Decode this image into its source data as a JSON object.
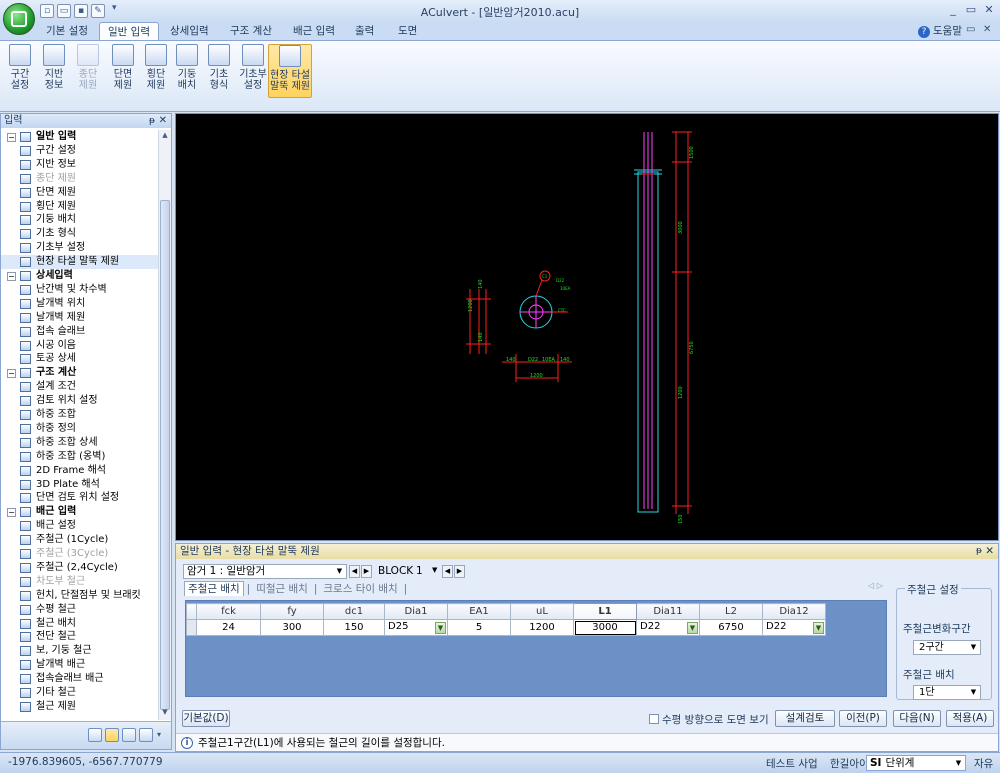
{
  "window": {
    "title": "ACulvert - [일반암거2010.acu]",
    "minimize": "_",
    "restore": "▭",
    "close": "✕"
  },
  "ribbon": {
    "tabs": [
      "기본 설정",
      "일반 입력",
      "상세입력",
      "구조 계산",
      "배근 입력",
      "출력",
      "도면"
    ],
    "active_tab": "일반 입력",
    "help_label": "도움말",
    "buttons": [
      {
        "label": "구간\n설정",
        "state": "normal"
      },
      {
        "label": "지반\n정보",
        "state": "normal"
      },
      {
        "label": "종단\n제원",
        "state": "disabled"
      },
      {
        "label": "단면\n제원",
        "state": "normal"
      },
      {
        "label": "횡단\n제원",
        "state": "normal"
      },
      {
        "label": "기둥\n배치",
        "state": "normal"
      },
      {
        "label": "기초\n형식",
        "state": "normal"
      },
      {
        "label": "기초부\n설정",
        "state": "normal"
      },
      {
        "label": "현장 타설\n말뚝 제원",
        "state": "active"
      }
    ]
  },
  "left_panel": {
    "title": "입력",
    "pin": "ᵽ",
    "close": "✕",
    "tree": [
      {
        "label": "일반 입력",
        "group": true,
        "toggle": "⊟"
      },
      {
        "label": "구간 설정"
      },
      {
        "label": "지반 정보"
      },
      {
        "label": "종단 제원",
        "disabled": true
      },
      {
        "label": "단면 제원"
      },
      {
        "label": "횡단 제원"
      },
      {
        "label": "기둥 배치"
      },
      {
        "label": "기초 형식"
      },
      {
        "label": "기초부 설정"
      },
      {
        "label": "현장 타설 말뚝 제원",
        "selected": true
      },
      {
        "label": "상세입력",
        "group": true,
        "toggle": "⊟"
      },
      {
        "label": "난간벽 및 차수벽"
      },
      {
        "label": "날개벽 위치"
      },
      {
        "label": "날개벽 제원"
      },
      {
        "label": "접속 슬래브"
      },
      {
        "label": "시공 이음"
      },
      {
        "label": "토공 상세"
      },
      {
        "label": "구조 계산",
        "group": true,
        "toggle": "⊟"
      },
      {
        "label": "설계 조건"
      },
      {
        "label": "검토 위치 설정"
      },
      {
        "label": "하중 조합"
      },
      {
        "label": "하중 정의"
      },
      {
        "label": "하중 조합 상세"
      },
      {
        "label": "하중 조합 (옹벽)"
      },
      {
        "label": "2D Frame 해석"
      },
      {
        "label": "3D Plate 해석"
      },
      {
        "label": "단면 검토 위치 설정"
      },
      {
        "label": "배근 입력",
        "group": true,
        "toggle": "⊟"
      },
      {
        "label": "배근 설정"
      },
      {
        "label": "주철근 (1Cycle)"
      },
      {
        "label": "주철근 (3Cycle)",
        "disabled": true
      },
      {
        "label": "주철근 (2,4Cycle)"
      },
      {
        "label": "차도부 철근",
        "disabled": true
      },
      {
        "label": "헌치, 단절점부 및 브래킷"
      },
      {
        "label": "수평 철근"
      },
      {
        "label": "철근 배치"
      },
      {
        "label": "전단 철근"
      },
      {
        "label": "보, 기둥 철근"
      },
      {
        "label": "날개벽 배근"
      },
      {
        "label": "접속슬래브 배근"
      },
      {
        "label": "기타 철근"
      },
      {
        "label": "철근 제원"
      }
    ]
  },
  "bottom_panel": {
    "title": "일반 입력 - 현장 타설 말뚝 제원",
    "pin": "ᵽ",
    "close": "✕",
    "culvert_select": "암거 1 : 일반암거",
    "block_label": "BLOCK",
    "block_value": "1",
    "subtabs": [
      "주철근 배치",
      "띠철근 배치",
      "크로스 타이 배치"
    ],
    "tab_arrows": "◁ ▷",
    "grid": {
      "headers": [
        "fck",
        "fy",
        "dc1",
        "Dia1",
        "EA1",
        "uL",
        "L1",
        "Dia11",
        "L2",
        "Dia12"
      ],
      "row": [
        "24",
        "300",
        "150",
        "D25",
        "5",
        "1200",
        "3000",
        "D22",
        "6750",
        "D22"
      ],
      "combo_cols": [
        3,
        7,
        9
      ],
      "highlight_col": 6
    },
    "settings": {
      "group_title": "주철근 설정",
      "section_label": "주철근변화구간",
      "section_value": "2구간",
      "layout_label": "주철근 배치",
      "layout_value": "1단"
    },
    "buttons": {
      "default": "기본값(D)",
      "check": "설계검토",
      "prev": "이전(P)",
      "next": "다음(N)",
      "apply": "적용(A)"
    },
    "checkbox_label": "수평 방향으로 도면 보기",
    "info": "주철근1구간(L1)에 사용되는 철근의 길이를 설정합니다."
  },
  "cad": {
    "circle_labels": [
      "D22",
      "10EA",
      "C1",
      "CTC"
    ],
    "plan_labels": [
      "140",
      "1200",
      "140",
      "D22",
      "10EA",
      "140",
      "1200",
      "140"
    ],
    "pile_labels": [
      "1500",
      "3000",
      "6750",
      "1200",
      "150"
    ]
  },
  "status": {
    "coords": "-1976.839605,  -6567.770779",
    "items": [
      "테스트 사업",
      "한길아이티"
    ],
    "unit_prefix": "SI",
    "unit_label": "단위계",
    "mode": "자유"
  },
  "colors": {
    "cad_bg": "#000000",
    "cad_red": "#ff2020",
    "cad_cyan": "#22d8e8",
    "cad_green": "#20e020",
    "cad_magenta": "#ff40ff",
    "panel_header": "#e8dda4"
  }
}
